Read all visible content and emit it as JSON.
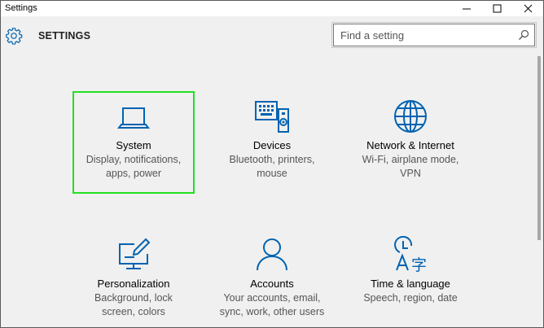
{
  "window": {
    "title": "Settings"
  },
  "header": {
    "title": "SETTINGS",
    "search_placeholder": "Find a setting"
  },
  "colors": {
    "accent": "#0063b1",
    "selection": "#22e022"
  },
  "tiles": [
    {
      "name": "System",
      "desc1": "Display, notifications,",
      "desc2": "apps, power",
      "icon": "laptop-icon"
    },
    {
      "name": "Devices",
      "desc1": "Bluetooth, printers,",
      "desc2": "mouse",
      "icon": "devices-icon"
    },
    {
      "name": "Network & Internet",
      "desc1": "Wi-Fi, airplane mode,",
      "desc2": "VPN",
      "icon": "globe-icon"
    },
    {
      "name": "Personalization",
      "desc1": "Background, lock",
      "desc2": "screen, colors",
      "icon": "personalization-icon"
    },
    {
      "name": "Accounts",
      "desc1": "Your accounts, email,",
      "desc2": "sync, work, other users",
      "icon": "person-icon"
    },
    {
      "name": "Time & language",
      "desc1": "Speech, region, date",
      "desc2": "",
      "icon": "time-language-icon"
    }
  ]
}
